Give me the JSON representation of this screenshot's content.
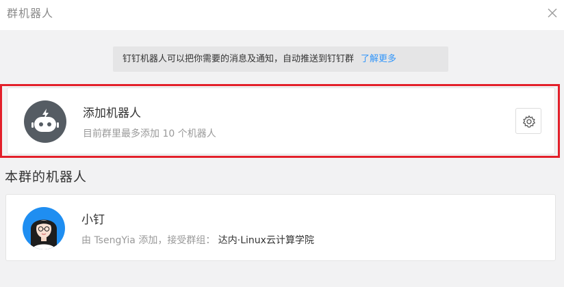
{
  "window": {
    "title": "群机器人",
    "close_icon": "close-icon"
  },
  "notice": {
    "text": "钉钉机器人可以把你需要的消息及通知，自动推送到钉钉群",
    "link": "了解更多"
  },
  "add_robot": {
    "name": "添加机器人",
    "description": "目前群里最多添加 10 个机器人",
    "icon": "robot-icon",
    "settings_icon": "gear-icon"
  },
  "section_title": "本群的机器人",
  "robots": [
    {
      "name": "小钉",
      "added_by_prefix": "由 TsengYia 添加，接受群组：",
      "group": "达内·Linux云计算学院",
      "icon": "girl-avatar-icon"
    }
  ],
  "colors": {
    "accent": "#3296fa",
    "highlight": "#e3202a",
    "robot_bg": "#555c63",
    "avatar_bg": "#1f8ef1"
  }
}
